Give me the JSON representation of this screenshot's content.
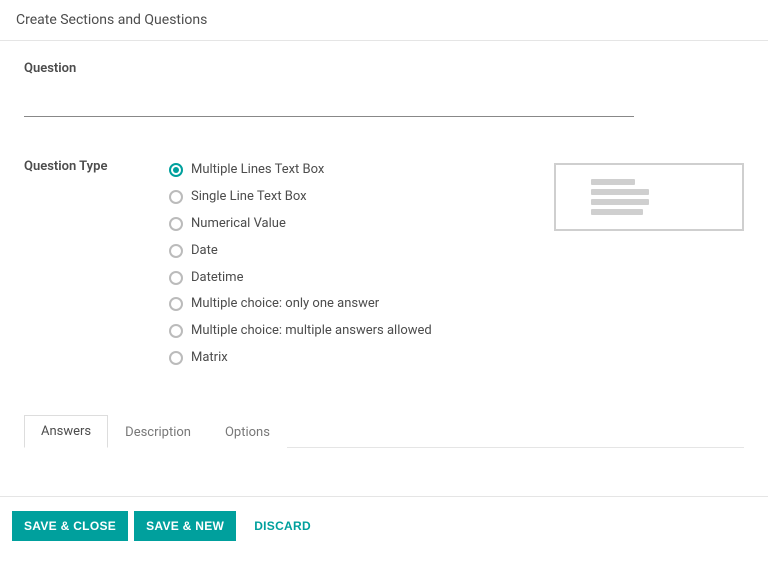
{
  "modal": {
    "title": "Create Sections and Questions"
  },
  "question": {
    "label": "Question",
    "value": ""
  },
  "questionType": {
    "label": "Question Type",
    "selectedIndex": 0,
    "options": [
      {
        "label": "Multiple Lines Text Box"
      },
      {
        "label": "Single Line Text Box"
      },
      {
        "label": "Numerical Value"
      },
      {
        "label": "Date"
      },
      {
        "label": "Datetime"
      },
      {
        "label": "Multiple choice: only one answer"
      },
      {
        "label": "Multiple choice: multiple answers allowed"
      },
      {
        "label": "Matrix"
      }
    ]
  },
  "tabs": {
    "activeIndex": 0,
    "items": [
      {
        "label": "Answers"
      },
      {
        "label": "Description"
      },
      {
        "label": "Options"
      }
    ]
  },
  "footer": {
    "saveClose": "SAVE & CLOSE",
    "saveNew": "SAVE & NEW",
    "discard": "DISCARD"
  },
  "colors": {
    "accent": "#00a09d"
  }
}
